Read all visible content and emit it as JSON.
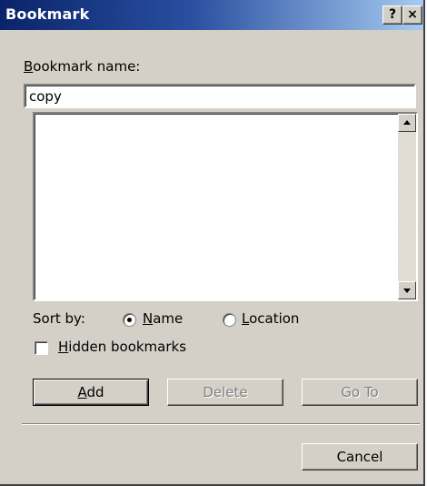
{
  "window": {
    "title": "Bookmark",
    "help_button": "?",
    "close_button": "×"
  },
  "bookmark_name": {
    "label_accel": "B",
    "label_rest": "ookmark name:",
    "value": "copy"
  },
  "bookmark_list": {
    "items": []
  },
  "sort_by": {
    "label": "Sort by:",
    "options": [
      {
        "accel": "N",
        "rest": "ame",
        "selected": true
      },
      {
        "accel": "L",
        "rest": "ocation",
        "selected": false
      }
    ]
  },
  "hidden_bookmarks": {
    "accel": "H",
    "rest": "idden bookmarks",
    "checked": false
  },
  "buttons": {
    "add_accel": "A",
    "add_rest": "dd",
    "delete": "Delete",
    "goto": "Go To",
    "cancel": "Cancel"
  }
}
